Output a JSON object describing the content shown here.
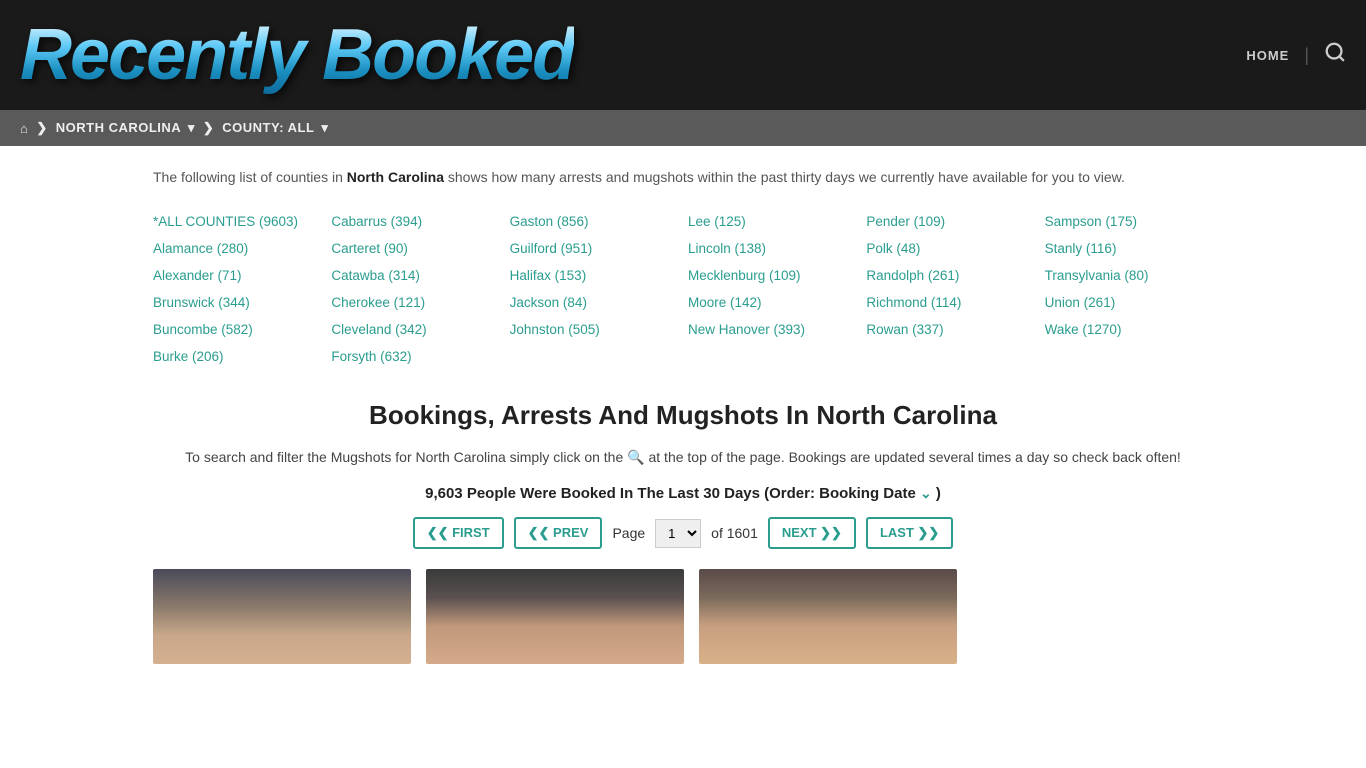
{
  "header": {
    "logo": "Recently Booked",
    "nav": {
      "home_label": "HOME"
    }
  },
  "breadcrumb": {
    "home_icon": "⌂",
    "state_label": "NORTH CAROLINA",
    "county_label": "COUNTY: ALL"
  },
  "intro": {
    "text_before": "The following list of counties in ",
    "state_bold": "North Carolina",
    "text_after": " shows how many arrests and mugshots within the past thirty days we currently have available for you to view."
  },
  "counties": [
    {
      "name": "*ALL COUNTIES",
      "count": 9603,
      "col": 1
    },
    {
      "name": "Cabarrus",
      "count": 394,
      "col": 2
    },
    {
      "name": "Gaston",
      "count": 856,
      "col": 3
    },
    {
      "name": "Lee",
      "count": 125,
      "col": 4
    },
    {
      "name": "Pender",
      "count": 109,
      "col": 5
    },
    {
      "name": "Sampson",
      "count": 175,
      "col": 6
    },
    {
      "name": "Alamance",
      "count": 280,
      "col": 1
    },
    {
      "name": "Carteret",
      "count": 90,
      "col": 2
    },
    {
      "name": "Guilford",
      "count": 951,
      "col": 3
    },
    {
      "name": "Lincoln",
      "count": 138,
      "col": 4
    },
    {
      "name": "Polk",
      "count": 48,
      "col": 5
    },
    {
      "name": "Stanly",
      "count": 116,
      "col": 6
    },
    {
      "name": "Alexander",
      "count": 71,
      "col": 1
    },
    {
      "name": "Catawba",
      "count": 314,
      "col": 2
    },
    {
      "name": "Halifax",
      "count": 153,
      "col": 3
    },
    {
      "name": "Mecklenburg",
      "count": 109,
      "col": 4
    },
    {
      "name": "Randolph",
      "count": 261,
      "col": 5
    },
    {
      "name": "Transylvania",
      "count": 80,
      "col": 6
    },
    {
      "name": "Brunswick",
      "count": 344,
      "col": 1
    },
    {
      "name": "Cherokee",
      "count": 121,
      "col": 2
    },
    {
      "name": "Jackson",
      "count": 84,
      "col": 3
    },
    {
      "name": "Moore",
      "count": 142,
      "col": 4
    },
    {
      "name": "Richmond",
      "count": 114,
      "col": 5
    },
    {
      "name": "Union",
      "count": 261,
      "col": 6
    },
    {
      "name": "Buncombe",
      "count": 582,
      "col": 1
    },
    {
      "name": "Cleveland",
      "count": 342,
      "col": 2
    },
    {
      "name": "Johnston",
      "count": 505,
      "col": 3
    },
    {
      "name": "New Hanover",
      "count": 393,
      "col": 4
    },
    {
      "name": "Rowan",
      "count": 337,
      "col": 5
    },
    {
      "name": "Wake",
      "count": 1270,
      "col": 6
    },
    {
      "name": "Burke",
      "count": 206,
      "col": 1
    },
    {
      "name": "Forsyth",
      "count": 632,
      "col": 2
    }
  ],
  "section": {
    "heading": "Bookings, Arrests And Mugshots In North Carolina",
    "search_desc_1": "To search and filter the Mugshots for North Carolina simply click on the",
    "search_desc_2": "at the top of the page. Bookings are updated several times a day so check back often!",
    "bookings_count": "9,603 People Were Booked In The Last 30 Days (Order: Booking Date",
    "sort_icon": "⌄"
  },
  "pagination": {
    "first_label": "❮❮ FIRST",
    "prev_label": "❮❮ PREV",
    "page_label": "Page",
    "current_page": "1",
    "of_text": "of 1601",
    "next_label": "NEXT ❯❯",
    "last_label": "LAST ❯❯"
  }
}
